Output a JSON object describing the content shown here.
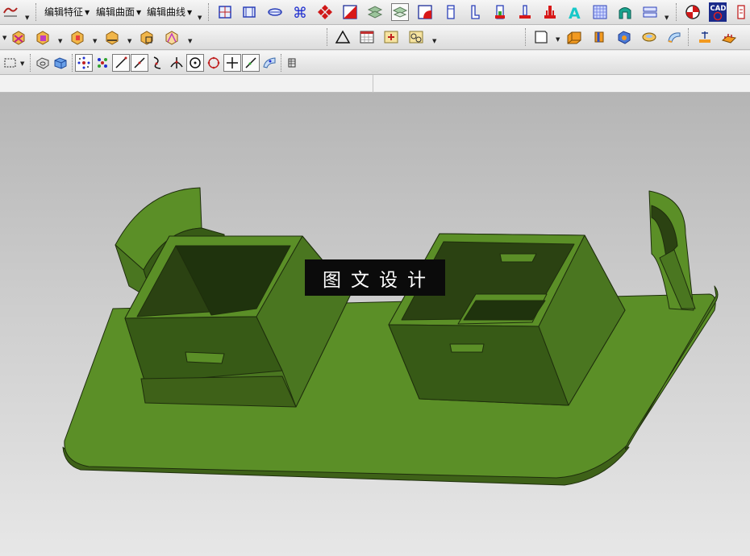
{
  "toolbar": {
    "menus": [
      {
        "label": "编辑特征"
      },
      {
        "label": "编辑曲面"
      },
      {
        "label": "编辑曲线"
      }
    ],
    "cad_badge": "CAD"
  },
  "viewport": {
    "watermark": "图文设计",
    "colors": {
      "background_top": "#b5b5b5",
      "background_bottom": "#e7e7e7",
      "part_top": "#5b8f27",
      "part_side": "#4a7620",
      "part_dark": "#2b4212",
      "part_edge": "#1e2e0c"
    }
  }
}
